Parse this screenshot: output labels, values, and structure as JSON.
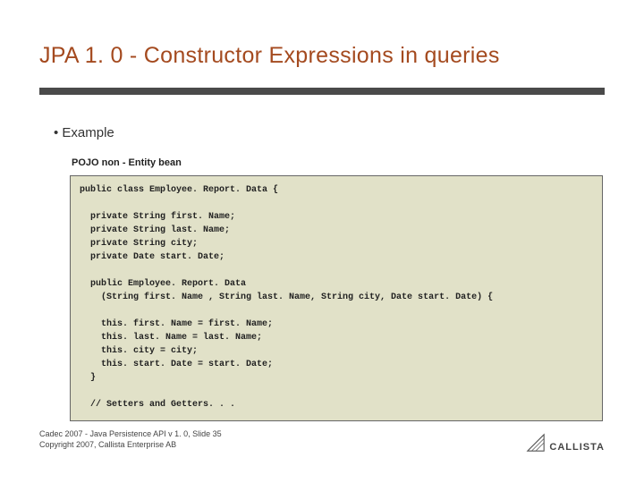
{
  "title": "JPA 1. 0 - Constructor Expressions in queries",
  "bullet": "•  Example",
  "subhead": "POJO non - Entity bean",
  "code": "public class Employee. Report. Data {\n\n  private String first. Name;\n  private String last. Name;\n  private String city;\n  private Date start. Date;\n\n  public Employee. Report. Data\n    (String first. Name , String last. Name, String city, Date start. Date) {\n\n    this. first. Name = first. Name;\n    this. last. Name = last. Name;\n    this. city = city;\n    this. start. Date = start. Date;\n  }\n\n  // Setters and Getters. . .",
  "footer_line1": "Cadec 2007 - Java Persistence API v 1. 0, Slide 35",
  "footer_line2": "Copyright 2007, Callista Enterprise AB",
  "logo_text": "CALLISTA"
}
